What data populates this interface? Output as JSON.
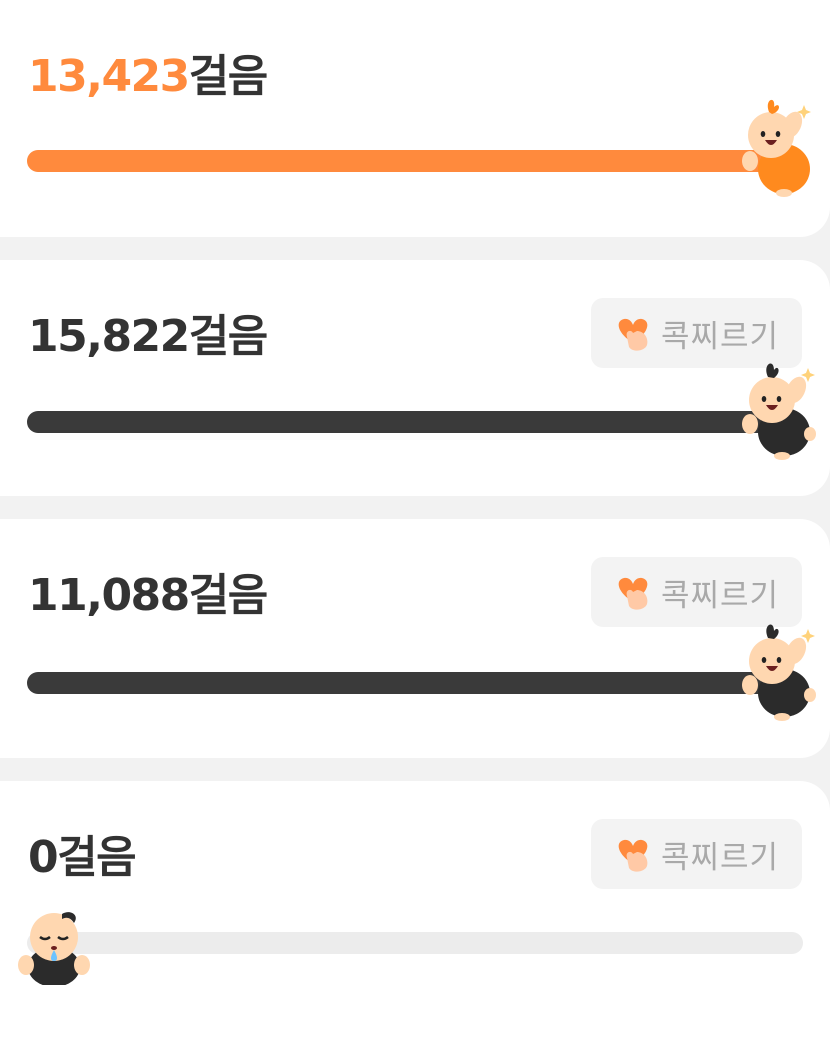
{
  "step_unit": "걸음",
  "poke_label": "콕찌르기",
  "colors": {
    "accent": "#ff8a3d",
    "dark": "#333333",
    "track_empty": "#ececec",
    "poke_bg": "#f3f3f3",
    "poke_text": "#a9a9a9"
  },
  "entries": [
    {
      "steps": "13,423",
      "is_me": true,
      "progress": 1.0,
      "avatar": "orange-mascot-icon"
    },
    {
      "steps": "15,822",
      "is_me": false,
      "progress": 1.0,
      "avatar": "black-mascot-icon"
    },
    {
      "steps": "11,088",
      "is_me": false,
      "progress": 1.0,
      "avatar": "black-mascot-icon"
    },
    {
      "steps": "0",
      "is_me": false,
      "progress": 0.0,
      "avatar": "sleepy-mascot-icon"
    }
  ]
}
